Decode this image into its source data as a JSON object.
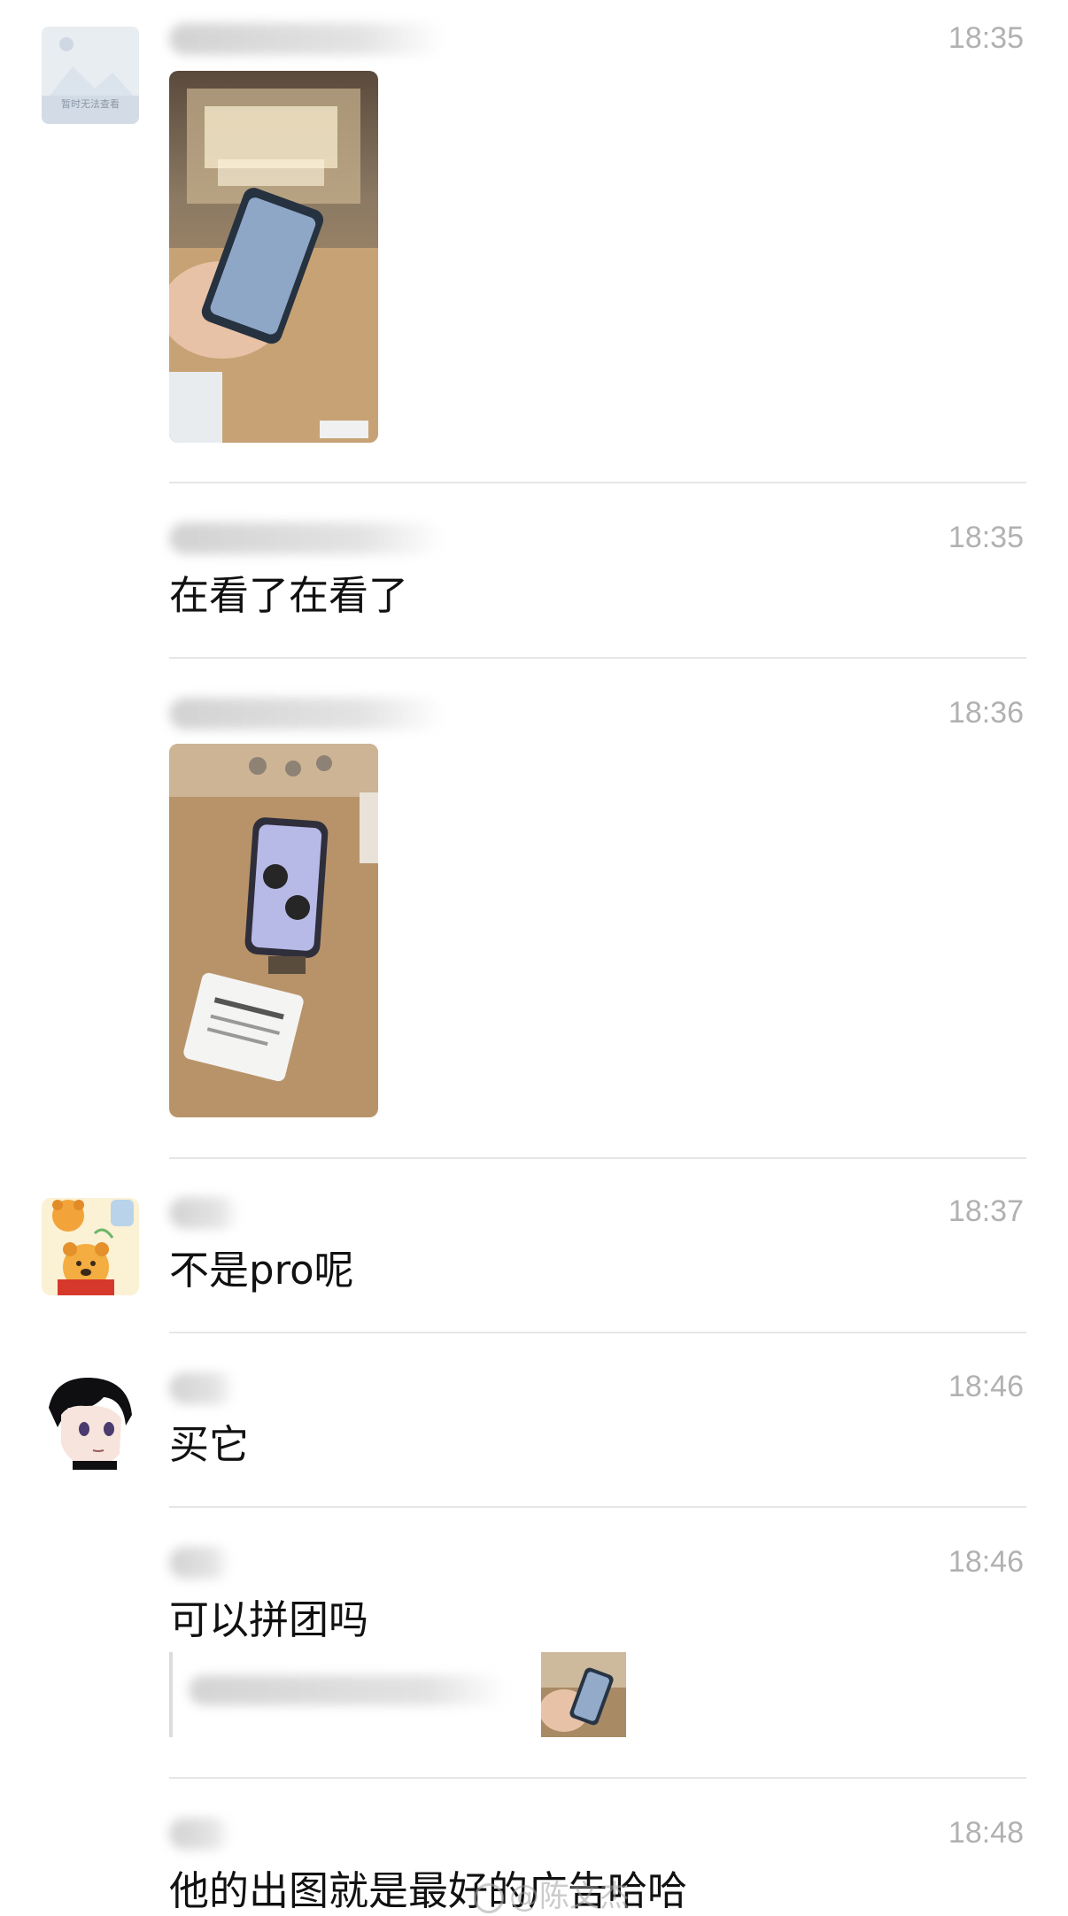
{
  "messages": [
    {
      "id": "m1",
      "time": "18:35",
      "avatar": "image-placeholder-icon",
      "avatar_text": "暂时无法查看",
      "type": "image",
      "image_desc": "hand-holding-phone-in-store-photo"
    },
    {
      "id": "m2",
      "time": "18:35",
      "type": "text",
      "text": "在看了在看了"
    },
    {
      "id": "m3",
      "time": "18:36",
      "type": "image",
      "image_desc": "phone-on-display-stand-photo"
    },
    {
      "id": "m4",
      "time": "18:37",
      "avatar": "winnie-the-pooh-avatar",
      "type": "text",
      "text": "不是pro呢"
    },
    {
      "id": "m5",
      "time": "18:46",
      "avatar": "anime-boy-avatar",
      "type": "text",
      "text": "买它"
    },
    {
      "id": "m6",
      "time": "18:46",
      "type": "text-with-quote",
      "text": "可以拼团吗",
      "quote_thumb": "quoted-phone-photo-thumbnail"
    },
    {
      "id": "m7",
      "time": "18:48",
      "type": "text",
      "text": "他的出图就是最好的广告哈哈"
    }
  ],
  "watermark": {
    "text": "@陈文杰"
  }
}
